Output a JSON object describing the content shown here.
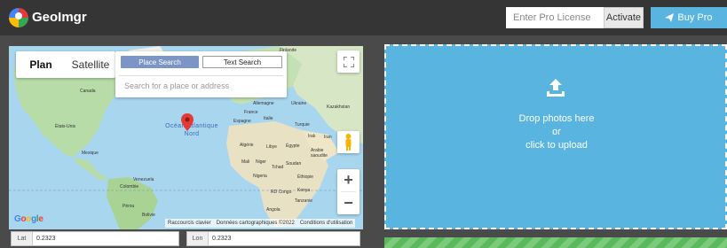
{
  "header": {
    "app_title": "GeoImgr",
    "license_placeholder": "Enter Pro License",
    "activate_label": "Activate",
    "buypro_label": "Buy Pro"
  },
  "map": {
    "type_tabs": [
      "Plan",
      "Satellite"
    ],
    "active_tab": "Plan",
    "place_search_label": "Place Search",
    "text_search_label": "Text Search",
    "search_placeholder": "Search for a place or address",
    "ocean_label": "Océan Atlantique Nord",
    "google_logo": "Google",
    "attribution": [
      "Raccourcis clavier",
      "Données cartographiques ©2022",
      "Conditions d'utilisation"
    ],
    "places": {
      "finlande": "Finlande",
      "canada": "Canada",
      "etats_unis": "États-Unis",
      "mexique": "Mexique",
      "allemagne": "Allemagne",
      "ukraine": "Ukraine",
      "kazakhstan": "Kazakhstan",
      "france": "France",
      "espagne": "Espagne",
      "italie": "Italie",
      "turquie": "Turquie",
      "irak": "Irak",
      "iran": "Iran",
      "algerie": "Algérie",
      "libye": "Libye",
      "egypte": "Égypte",
      "arabie": "Arabie saoudite",
      "mali": "Mali",
      "niger": "Niger",
      "tchad": "Tchad",
      "soudan": "Soudan",
      "nigeria": "Nigeria",
      "ethiopie": "Éthiopie",
      "rdcongo": "RD Congo",
      "kenya": "Kenya",
      "tanzanie": "Tanzanie",
      "angola": "Angola",
      "venezuela": "Venezuela",
      "colombie": "Colombie",
      "perou": "Pérou",
      "bolivie": "Bolivie"
    }
  },
  "coords": {
    "lat_label": "Lat",
    "lat_value": "0.2323",
    "lon_label": "Lon",
    "lon_value": "0.2323"
  },
  "upload": {
    "line1": "Drop photos here",
    "line2": "or",
    "line3": "click to upload"
  },
  "colors": {
    "header_bg": "#353535",
    "page_bg": "#4a4a4a",
    "accent_blue": "#5ab4e0",
    "stripe_green": "#5cb85c",
    "pin_red": "#e23b3b"
  },
  "icons": [
    "globe-pin-logo-icon",
    "paper-plane-icon",
    "fullscreen-icon",
    "pegman-icon",
    "map-pin-icon",
    "upload-icon"
  ]
}
